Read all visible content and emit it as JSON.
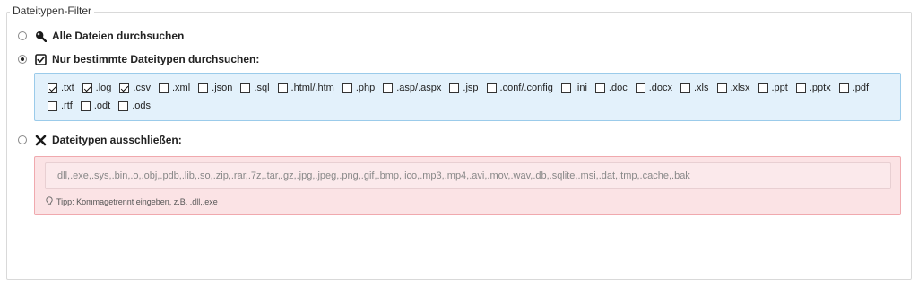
{
  "group": {
    "legend": "Dateitypen-Filter"
  },
  "options": {
    "all": {
      "label": "Alle Dateien durchsuchen",
      "selected": false,
      "icon": "search-icon"
    },
    "specific": {
      "label": "Nur bestimmte Dateitypen durchsuchen:",
      "selected": true,
      "icon": "checkbox-icon"
    },
    "exclude": {
      "label": "Dateitypen ausschließen:",
      "selected": false,
      "icon": "close-icon"
    }
  },
  "file_types": [
    {
      "label": ".txt",
      "checked": true
    },
    {
      "label": ".log",
      "checked": true
    },
    {
      "label": ".csv",
      "checked": true
    },
    {
      "label": ".xml",
      "checked": false
    },
    {
      "label": ".json",
      "checked": false
    },
    {
      "label": ".sql",
      "checked": false
    },
    {
      "label": ".html/.htm",
      "checked": false
    },
    {
      "label": ".php",
      "checked": false
    },
    {
      "label": ".asp/.aspx",
      "checked": false
    },
    {
      "label": ".jsp",
      "checked": false
    },
    {
      "label": ".conf/.config",
      "checked": false
    },
    {
      "label": ".ini",
      "checked": false
    },
    {
      "label": ".doc",
      "checked": false
    },
    {
      "label": ".docx",
      "checked": false
    },
    {
      "label": ".xls",
      "checked": false
    },
    {
      "label": ".xlsx",
      "checked": false
    },
    {
      "label": ".ppt",
      "checked": false
    },
    {
      "label": ".pptx",
      "checked": false
    },
    {
      "label": ".pdf",
      "checked": false
    },
    {
      "label": ".rtf",
      "checked": false
    },
    {
      "label": ".odt",
      "checked": false
    },
    {
      "label": ".ods",
      "checked": false
    }
  ],
  "exclude": {
    "value": "",
    "placeholder": ".dll,.exe,.sys,.bin,.o,.obj,.pdb,.lib,.so,.zip,.rar,.7z,.tar,.gz,.jpg,.jpeg,.png,.gif,.bmp,.ico,.mp3,.mp4,.avi,.mov,.wav,.db,.sqlite,.msi,.dat,.tmp,.cache,.bak",
    "hint": "Tipp: Kommagetrennt eingeben, z.B. .dll,.exe",
    "hint_icon": "lightbulb-icon"
  }
}
